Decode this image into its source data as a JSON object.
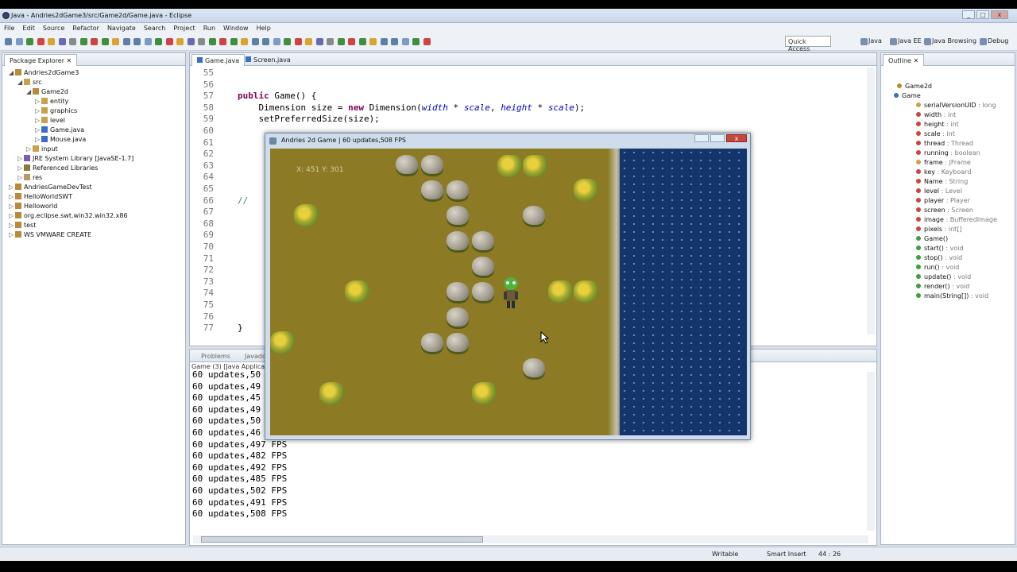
{
  "window": {
    "title": "Java - Andries2dGame3/src/Game2d/Game.java - Eclipse"
  },
  "menu": [
    "File",
    "Edit",
    "Source",
    "Refactor",
    "Navigate",
    "Search",
    "Project",
    "Run",
    "Window",
    "Help"
  ],
  "toolbar": {
    "quick_access": "Quick Access",
    "perspectives": [
      "Java",
      "Java EE",
      "Java Browsing",
      "Debug"
    ]
  },
  "package_explorer": {
    "title": "Package Explorer",
    "items": [
      {
        "label": "Andries2dGame3",
        "level": 0
      },
      {
        "label": "src",
        "level": 1
      },
      {
        "label": "Game2d",
        "level": 2
      },
      {
        "label": "entity",
        "level": 3
      },
      {
        "label": "graphics",
        "level": 3
      },
      {
        "label": "level",
        "level": 3
      },
      {
        "label": "Game.java",
        "level": 3
      },
      {
        "label": "Mouse.java",
        "level": 3
      },
      {
        "label": "input",
        "level": 2
      },
      {
        "label": "JRE System Library [JavaSE-1.7]",
        "level": 1
      },
      {
        "label": "Referenced Libraries",
        "level": 1
      },
      {
        "label": "res",
        "level": 1
      },
      {
        "label": "AndriesGameDevTest",
        "level": 0
      },
      {
        "label": "HelloWorldSWT",
        "level": 0
      },
      {
        "label": "Helloworld",
        "level": 0
      },
      {
        "label": "org.eclipse.swt.win32.win32.x86",
        "level": 0
      },
      {
        "label": "test",
        "level": 0
      },
      {
        "label": "WS VMWARE CREATE",
        "level": 0
      }
    ]
  },
  "editor": {
    "tabs": [
      "Game.java",
      "Screen.java"
    ],
    "lines": [
      {
        "n": "55",
        "code": ""
      },
      {
        "n": "56",
        "code": ""
      },
      {
        "n": "57",
        "code": "public Game() {"
      },
      {
        "n": "58",
        "code": "    Dimension size = new Dimension(width * scale, height * scale);"
      },
      {
        "n": "59",
        "code": "    setPreferredSize(size);"
      },
      {
        "n": "60",
        "code": ""
      },
      {
        "n": "61",
        "code": ""
      },
      {
        "n": "62",
        "code": ""
      },
      {
        "n": "63",
        "code": ""
      },
      {
        "n": "64",
        "code": ""
      },
      {
        "n": "65",
        "code": ""
      },
      {
        "n": "66",
        "code": "//"
      },
      {
        "n": "67",
        "code": ""
      },
      {
        "n": "68",
        "code": ""
      },
      {
        "n": "69",
        "code": ""
      },
      {
        "n": "70",
        "code": ""
      },
      {
        "n": "71",
        "code": ""
      },
      {
        "n": "72",
        "code": ""
      },
      {
        "n": "73",
        "code": ""
      },
      {
        "n": "74",
        "code": ""
      },
      {
        "n": "75",
        "code": ""
      },
      {
        "n": "76",
        "code": ""
      },
      {
        "n": "77",
        "code": "}"
      }
    ]
  },
  "console": {
    "tabs": [
      "Problems",
      "Javadoc"
    ],
    "header": "Game (3) [Java Application",
    "lines": [
      "60 updates,50",
      "60 updates,49",
      "60 updates,45",
      "60 updates,49",
      "60 updates,50",
      "60 updates,46",
      "60 updates,497 FPS",
      "60 updates,482 FPS",
      "60 updates,492 FPS",
      "60 updates,485 FPS",
      "60 updates,502 FPS",
      "60 updates,491 FPS",
      "60 updates,508 FPS"
    ]
  },
  "outline": {
    "title": "Outline",
    "items": [
      {
        "label": "Game2d",
        "type": "",
        "kind": "package"
      },
      {
        "label": "Game",
        "type": "",
        "kind": "class"
      },
      {
        "label": "serialVersionUID",
        "type": " : long",
        "kind": "field"
      },
      {
        "label": "width",
        "type": " : int",
        "kind": "field"
      },
      {
        "label": "height",
        "type": " : int",
        "kind": "field"
      },
      {
        "label": "scale",
        "type": " : int",
        "kind": "field"
      },
      {
        "label": "thread",
        "type": " : Thread",
        "kind": "field"
      },
      {
        "label": "running",
        "type": " : boolean",
        "kind": "field"
      },
      {
        "label": "frame",
        "type": " : JFrame",
        "kind": "field"
      },
      {
        "label": "key",
        "type": " : Keyboard",
        "kind": "field"
      },
      {
        "label": "Name",
        "type": " : String",
        "kind": "field"
      },
      {
        "label": "level",
        "type": " : Level",
        "kind": "field"
      },
      {
        "label": "player",
        "type": " : Player",
        "kind": "field"
      },
      {
        "label": "screen",
        "type": " : Screen",
        "kind": "field"
      },
      {
        "label": "image",
        "type": " : BufferedImage",
        "kind": "field"
      },
      {
        "label": "pixels",
        "type": " : int[]",
        "kind": "field"
      },
      {
        "label": "Game()",
        "type": "",
        "kind": "method"
      },
      {
        "label": "start()",
        "type": " : void",
        "kind": "method"
      },
      {
        "label": "stop()",
        "type": " : void",
        "kind": "method"
      },
      {
        "label": "run()",
        "type": " : void",
        "kind": "method"
      },
      {
        "label": "update()",
        "type": " : void",
        "kind": "method"
      },
      {
        "label": "render()",
        "type": " : void",
        "kind": "method"
      },
      {
        "label": "main(String[])",
        "type": " : void",
        "kind": "method"
      }
    ]
  },
  "game_window": {
    "title": "Andries 2d Game | 60 updates,508 FPS",
    "coords": "X: 451 Y: 301"
  },
  "status": {
    "writable": "Writable",
    "insert": "Smart Insert",
    "position": "44 : 26"
  },
  "colors": {
    "grass": "#8c7a24",
    "water": "#13356b",
    "keyword": "#7f0055",
    "field": "#0000c0"
  }
}
